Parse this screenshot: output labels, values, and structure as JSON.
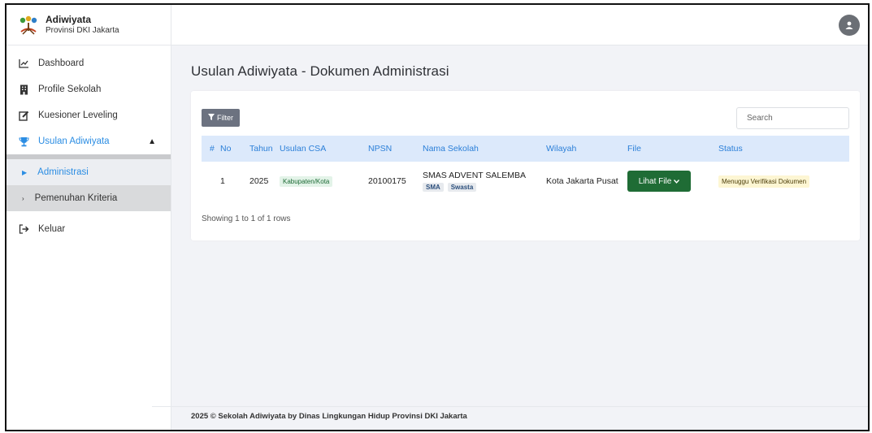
{
  "brand": {
    "title": "Adiwiyata",
    "subtitle": "Provinsi DKI Jakarta"
  },
  "sidebar": {
    "items": [
      {
        "label": "Dashboard",
        "icon": "chart-line-icon"
      },
      {
        "label": "Profile Sekolah",
        "icon": "building-icon"
      },
      {
        "label": "Kuesioner Leveling",
        "icon": "edit-icon"
      },
      {
        "label": "Usulan Adiwiyata",
        "icon": "trophy-icon",
        "active": true,
        "chevron": "chevron-up-icon"
      },
      {
        "label": "Keluar",
        "icon": "sign-out-icon"
      }
    ],
    "submenu": [
      {
        "label": "Administrasi",
        "current": true
      },
      {
        "label": "Pemenuhan Kriteria"
      }
    ]
  },
  "topbar": {
    "avatar_icon": "user-avatar-icon"
  },
  "page": {
    "title": "Usulan Adiwiyata - Dokumen Administrasi"
  },
  "toolbar": {
    "filter_label": "Filter",
    "search_placeholder": "Search"
  },
  "table": {
    "headers": [
      "#",
      "No",
      "Tahun",
      "Usulan CSA",
      "NPSN",
      "Nama Sekolah",
      "Wilayah",
      "File",
      "Status"
    ],
    "rows": [
      {
        "hash": "",
        "no": "1",
        "tahun": "2025",
        "usulan_csa": "Kabupaten/Kota",
        "npsn": "20100175",
        "nama": "SMAS ADVENT SALEMBA",
        "jenjang": "SMA",
        "tipe": "Swasta",
        "wilayah": "Kota Jakarta Pusat",
        "file_button": "Lihat File",
        "status": "Menuggu Verifikasi Dokumen"
      }
    ],
    "showing": "Showing 1 to 1 of 1 rows"
  },
  "footer": {
    "text": "2025 © Sekolah Adiwiyata by Dinas Lingkungan Hidup Provinsi DKI Jakarta"
  },
  "colors": {
    "accent": "#2b8de3",
    "header_bg": "#dce9fb",
    "lihat_green": "#1f6c35",
    "status_yellow": "#fdf6d3"
  }
}
